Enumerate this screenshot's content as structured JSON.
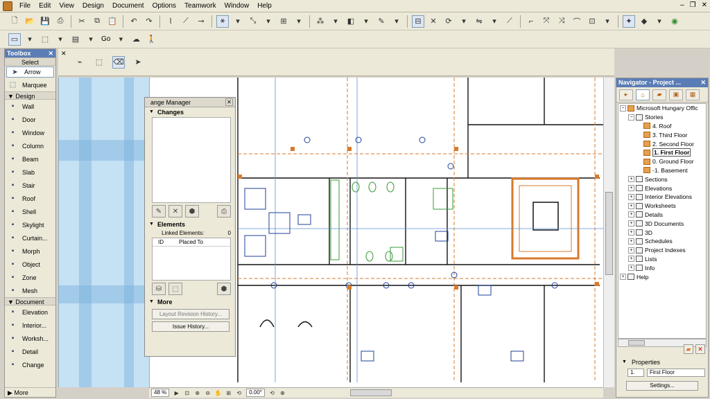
{
  "menubar": {
    "items": [
      "File",
      "Edit",
      "View",
      "Design",
      "Document",
      "Options",
      "Teamwork",
      "Window",
      "Help"
    ]
  },
  "toolbar2": {
    "go_label": "Go"
  },
  "toolbox": {
    "title": "Toolbox",
    "select_section": "Select",
    "select_tools": [
      {
        "label": "Arrow",
        "icon": "arrow-icon"
      },
      {
        "label": "Marquee",
        "icon": "marquee-icon"
      }
    ],
    "design_section": "Design",
    "design_tools": [
      {
        "label": "Wall",
        "icon": "wall-icon"
      },
      {
        "label": "Door",
        "icon": "door-icon"
      },
      {
        "label": "Window",
        "icon": "window-icon"
      },
      {
        "label": "Column",
        "icon": "column-icon"
      },
      {
        "label": "Beam",
        "icon": "beam-icon"
      },
      {
        "label": "Slab",
        "icon": "slab-icon"
      },
      {
        "label": "Stair",
        "icon": "stair-icon"
      },
      {
        "label": "Roof",
        "icon": "roof-icon"
      },
      {
        "label": "Shell",
        "icon": "shell-icon"
      },
      {
        "label": "Skylight",
        "icon": "skylight-icon"
      },
      {
        "label": "Curtain...",
        "icon": "curtain-wall-icon"
      },
      {
        "label": "Morph",
        "icon": "morph-icon"
      },
      {
        "label": "Object",
        "icon": "object-icon"
      },
      {
        "label": "Zone",
        "icon": "zone-icon"
      },
      {
        "label": "Mesh",
        "icon": "mesh-icon"
      }
    ],
    "document_section": "Document",
    "document_tools": [
      {
        "label": "Elevation",
        "icon": "elevation-icon"
      },
      {
        "label": "Interior...",
        "icon": "interior-elevation-icon"
      },
      {
        "label": "Worksh...",
        "icon": "worksheet-icon"
      },
      {
        "label": "Detail",
        "icon": "detail-icon"
      },
      {
        "label": "Change",
        "icon": "change-icon"
      }
    ],
    "more_label": "More"
  },
  "change_manager": {
    "title": "ange Manager",
    "changes_header": "Changes",
    "elements_header": "Elements",
    "linked_elements_label": "Linked Elements:",
    "linked_elements_count": "0",
    "col_id": "ID",
    "col_placed_to": "Placed To",
    "more_header": "More",
    "layout_revision_button": "Layout Revision History...",
    "issue_history_button": "Issue History..."
  },
  "navigator": {
    "title": "Navigator - Project ...",
    "project_name": "Microsoft Hungary Offic",
    "stories_label": "Stories",
    "stories": [
      "4. Roof",
      "3. Third Floor",
      "2. Second Floor",
      "1. First Floor",
      "0. Ground Floor",
      "-1. Basement"
    ],
    "current_story": "1. First Floor",
    "categories": [
      "Sections",
      "Elevations",
      "Interior Elevations",
      "Worksheets",
      "Details",
      "3D Documents",
      "3D",
      "Schedules",
      "Project Indexes",
      "Lists",
      "Info"
    ],
    "help_label": "Help",
    "properties_header": "Properties",
    "property_index": "1.",
    "property_name": "First Floor",
    "settings_button": "Settings..."
  },
  "statusbar": {
    "zoom": "48 %",
    "angle": "0.00°"
  },
  "colors": {
    "wall_orange": "#d97a2b",
    "plan_blue": "#1f3f9a",
    "toilet_green": "#3a9a3a",
    "ghost_blue": "#96c8eb"
  }
}
